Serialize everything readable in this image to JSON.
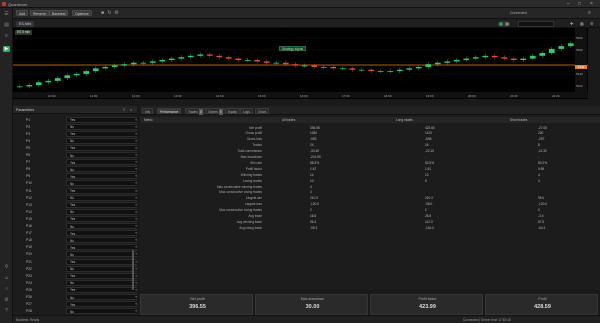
{
  "app": {
    "title": "Quantower"
  },
  "toolbar": {
    "buttons": [
      "Add",
      "Remove"
    ],
    "mode_buttons": [
      "Backtest",
      "Optimize"
    ],
    "right_label": "Connected"
  },
  "symbol_tab": {
    "label": "ES-Mini"
  },
  "chart": {
    "badge": "ES 5 min",
    "top_badge": "Strategy signal",
    "last_price_label": "5340",
    "y_ticks": [
      "5360",
      "5350",
      "5340",
      "5330",
      "5320"
    ],
    "x_ticks": [
      "10:00",
      "11:00",
      "12:00",
      "13:00",
      "14:00",
      "15:00",
      "16:00",
      "17:00",
      "18:00",
      "19:00",
      "20:00",
      "21:00",
      "22:00"
    ]
  },
  "chart_data": {
    "type": "line",
    "title": "",
    "xlabel": "",
    "ylabel": "",
    "ylim": [
      5318,
      5364
    ],
    "series": [
      {
        "name": "",
        "values": [
          5322,
          5323,
          5325,
          5326,
          5328,
          5330,
          5331,
          5333,
          5335,
          5336,
          5337,
          5338,
          5339,
          5339,
          5340,
          5341,
          5342,
          5343,
          5344,
          5345,
          5344,
          5343,
          5342,
          5341,
          5341,
          5340,
          5339,
          5339,
          5338,
          5337,
          5337,
          5336,
          5336,
          5335,
          5335,
          5334,
          5334,
          5333,
          5333,
          5333,
          5334,
          5335,
          5336,
          5338,
          5339,
          5340,
          5341,
          5342,
          5343,
          5344,
          5343,
          5342,
          5341,
          5342,
          5344,
          5346,
          5349,
          5351,
          5353,
          5355
        ]
      }
    ]
  },
  "params_panel": {
    "title": "Parameters",
    "rows": [
      {
        "name": "P1",
        "value": "Yes"
      },
      {
        "name": "P2",
        "value": "No"
      },
      {
        "name": "P3",
        "value": "Yes"
      },
      {
        "name": "P4",
        "value": "No"
      },
      {
        "name": "P5",
        "value": "Yes"
      },
      {
        "name": "P6",
        "value": "No"
      },
      {
        "name": "P7",
        "value": "Yes"
      },
      {
        "name": "P8",
        "value": "No"
      },
      {
        "name": "P9",
        "value": "Yes"
      },
      {
        "name": "P10",
        "value": "No"
      },
      {
        "name": "P11",
        "value": "Yes"
      },
      {
        "name": "P12",
        "value": "No"
      },
      {
        "name": "P13",
        "value": "Yes"
      },
      {
        "name": "P14",
        "value": "No"
      },
      {
        "name": "P15",
        "value": "Yes"
      },
      {
        "name": "P16",
        "value": "No"
      },
      {
        "name": "P17",
        "value": "Yes"
      },
      {
        "name": "P18",
        "value": "No"
      },
      {
        "name": "P19",
        "value": "Yes"
      },
      {
        "name": "P20",
        "value": "No"
      },
      {
        "name": "P21",
        "value": "Yes"
      },
      {
        "name": "P22",
        "value": "No"
      },
      {
        "name": "P23",
        "value": "Yes"
      },
      {
        "name": "P24",
        "value": "No"
      },
      {
        "name": "P25",
        "value": "Yes"
      },
      {
        "name": "P26",
        "value": "No"
      },
      {
        "name": "P27",
        "value": "Yes"
      },
      {
        "name": "P28",
        "value": "No"
      }
    ]
  },
  "results_tabs": [
    {
      "label": "Info",
      "count": ""
    },
    {
      "label": "Performance",
      "count": ""
    },
    {
      "label": "Trades",
      "count": "0"
    },
    {
      "label": "Orders",
      "count": "0"
    },
    {
      "label": "Equity",
      "count": ""
    },
    {
      "label": "Logs",
      "count": ""
    },
    {
      "label": "Chart",
      "count": ""
    }
  ],
  "results_table": {
    "headers": [
      "Metric",
      "All trades",
      "Long trades",
      "Short trades"
    ],
    "rows": [
      {
        "label": "Net profit",
        "values": [
          "396.55",
          "423.60",
          "-27.05"
        ]
      },
      {
        "label": "Gross profit",
        "values": [
          "1350",
          "1120",
          "230"
        ]
      },
      {
        "label": "Gross loss",
        "values": [
          "-953",
          "-696",
          "-257"
        ]
      },
      {
        "label": "Trades",
        "values": [
          "24",
          "16",
          "8"
        ]
      },
      {
        "label": "Total commission",
        "values": [
          "-33.40",
          "-22.10",
          "-11.30"
        ]
      },
      {
        "label": "Max drawdown",
        "values": [
          "-241.50",
          "-",
          "-"
        ]
      },
      {
        "label": "Win rate",
        "values": [
          "58.3%",
          "62.5%",
          "50.0%"
        ]
      },
      {
        "label": "Profit factor",
        "values": [
          "1.42",
          "1.61",
          "0.89"
        ]
      },
      {
        "label": "Winning trades",
        "values": [
          "14",
          "10",
          "4"
        ]
      },
      {
        "label": "Losing trades",
        "values": [
          "10",
          "6",
          "4"
        ]
      },
      {
        "label": "Max consecutive winning trades",
        "values": [
          "4",
          "",
          ""
        ]
      },
      {
        "label": "Max consecutive losing trades",
        "values": [
          "3",
          "",
          ""
        ]
      },
      {
        "label": "Largest win",
        "values": [
          "210.0",
          "210.0",
          "95.0"
        ]
      },
      {
        "label": "Largest loss",
        "values": [
          "-120.0",
          "-98.0",
          "-120.0"
        ]
      },
      {
        "label": "Max consecutive losing trades",
        "values": [
          "2",
          "2",
          "0"
        ]
      },
      {
        "label": "Avg trade",
        "values": [
          "16.5",
          "26.5",
          "-3.4"
        ]
      },
      {
        "label": "Avg winning trade",
        "values": [
          "96.4",
          "112.0",
          "57.5"
        ]
      },
      {
        "label": "Avg losing trade",
        "values": [
          "-95.3",
          "-116.0",
          "-64.3"
        ]
      }
    ]
  },
  "summary_cards": [
    {
      "title": "Net profit",
      "value": "396.55"
    },
    {
      "title": "Max drawdown",
      "value": "30.00"
    },
    {
      "title": "Profit factor",
      "value": "423.99"
    },
    {
      "title": "Profit",
      "value": "428.59"
    }
  ],
  "statusbar": {
    "left": "Backtest: Ready",
    "right": "Connected  |  Server time  17:53:48"
  }
}
